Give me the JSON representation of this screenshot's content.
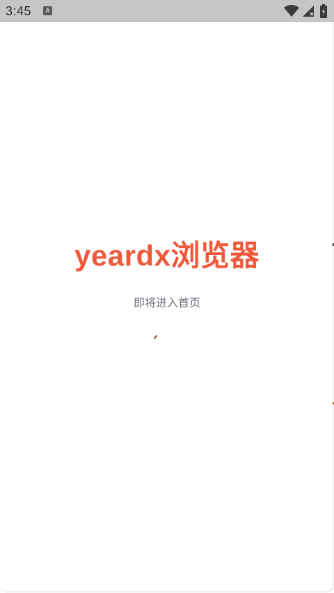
{
  "status_bar": {
    "time": "3:45",
    "notification_icon_letter": "A",
    "icons": [
      "wifi-icon",
      "cellular-signal-icon",
      "battery-icon"
    ]
  },
  "splash": {
    "title": "yeardx浏览器",
    "subtitle": "即将进入首页"
  },
  "colors": {
    "status_bar_bg": "#c6c6c6",
    "brand_accent": "#f0583a",
    "subtitle_text": "#6b6f7a",
    "background": "#ffffff"
  }
}
